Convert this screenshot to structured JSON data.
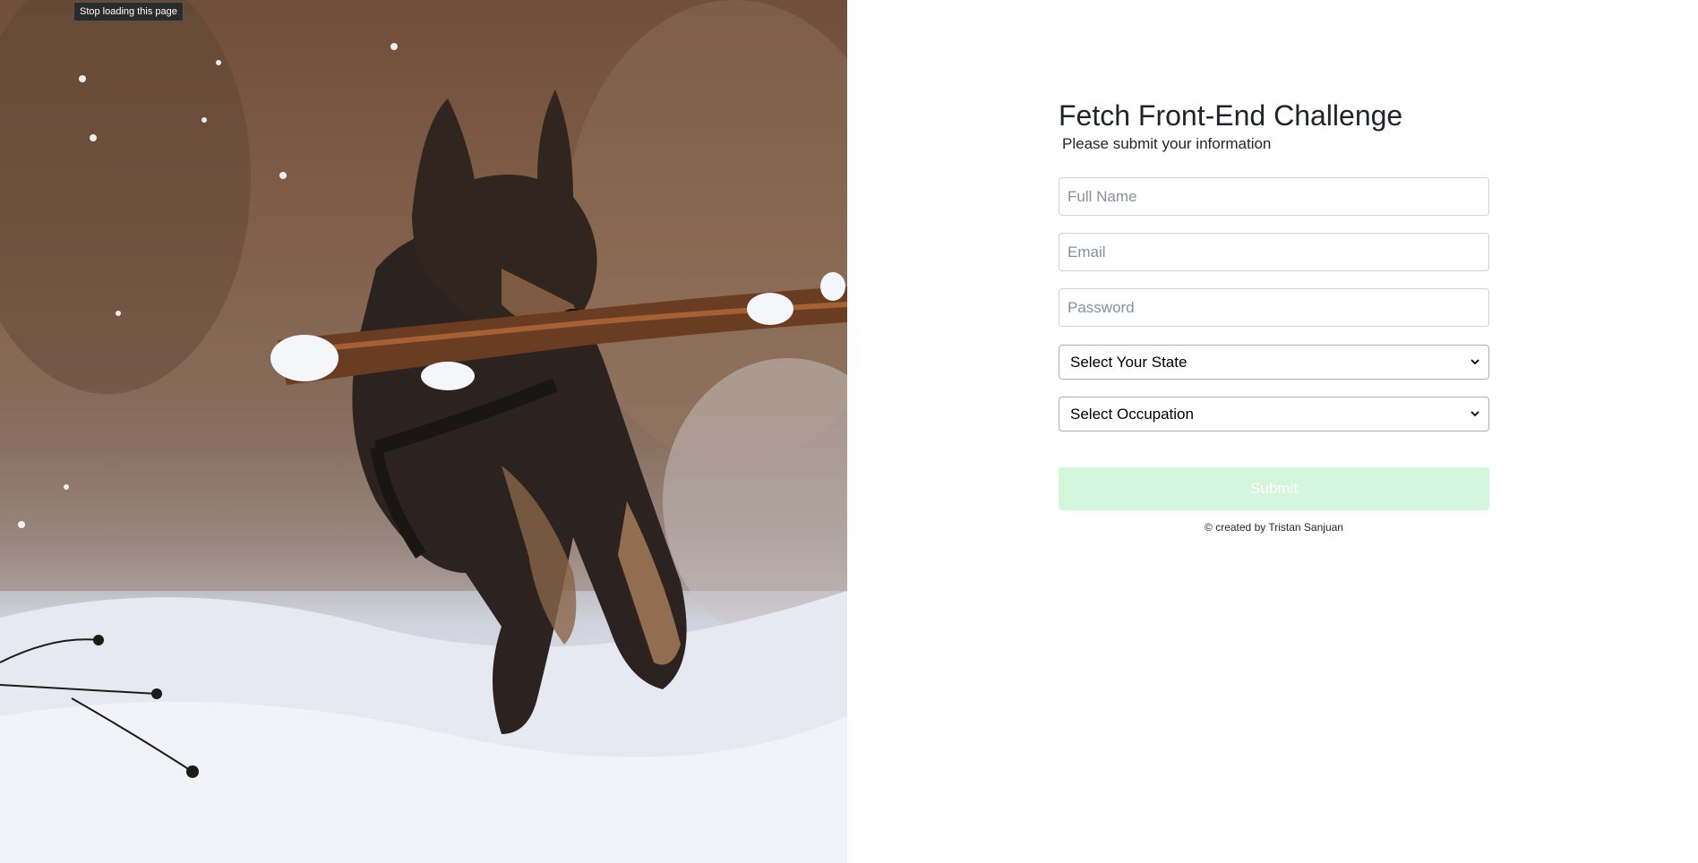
{
  "browser": {
    "tooltip": "Stop loading this page"
  },
  "hero": {
    "image_description_icon": "dog-photo-icon"
  },
  "form": {
    "title": "Fetch Front-End Challenge",
    "subtitle": "Please submit your information",
    "full_name_placeholder": "Full Name",
    "email_placeholder": "Email",
    "password_placeholder": "Password",
    "state_select_value": "Select Your State",
    "occupation_select_value": "Select Occupation",
    "submit_label": "Submit",
    "submit_color": "#d4f6dc",
    "credit": "© created by Tristan Sanjuan"
  }
}
